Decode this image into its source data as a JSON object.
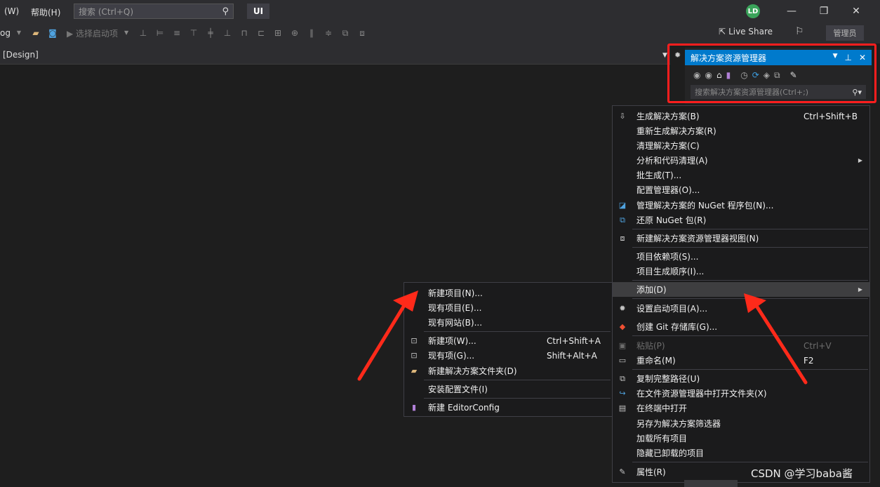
{
  "titlebar": {
    "menu_window": "(W)",
    "menu_help": "帮助(H)",
    "search_placeholder": "搜索 (Ctrl+Q)",
    "project_badge": "UI",
    "avatar_initials": "LD"
  },
  "toolbar": {
    "config_fragment": "og",
    "start_label": "▶ 选择启动项",
    "live_share": "Live Share",
    "admin_label": "管理员"
  },
  "document": {
    "tab_label": "[Design]"
  },
  "solution_explorer": {
    "title": "解决方案资源管理器",
    "search_placeholder": "搜索解决方案资源管理器(Ctrl+;)"
  },
  "context_menu": {
    "items": [
      {
        "label": "生成解决方案(B)",
        "shortcut": "Ctrl+Shift+B",
        "icon": "build-icon"
      },
      {
        "label": "重新生成解决方案(R)",
        "shortcut": "",
        "icon": ""
      },
      {
        "label": "清理解决方案(C)",
        "shortcut": "",
        "icon": ""
      },
      {
        "label": "分析和代码清理(A)",
        "shortcut": "",
        "icon": ""
      },
      {
        "label": "批生成(T)...",
        "shortcut": "",
        "icon": ""
      },
      {
        "label": "配置管理器(O)...",
        "shortcut": "",
        "icon": ""
      },
      {
        "label": "管理解决方案的 NuGet 程序包(N)...",
        "shortcut": "",
        "icon": "nuget-icon"
      },
      {
        "label": "还原 NuGet 包(R)",
        "shortcut": "",
        "icon": "restore-icon"
      },
      {
        "label": "新建解决方案资源管理器视图(N)",
        "shortcut": "",
        "icon": "new-view-icon"
      },
      {
        "label": "项目依赖项(S)...",
        "shortcut": "",
        "icon": ""
      },
      {
        "label": "项目生成顺序(I)...",
        "shortcut": "",
        "icon": ""
      },
      {
        "label": "添加(D)",
        "shortcut": "",
        "icon": ""
      },
      {
        "label": "设置启动项目(A)...",
        "shortcut": "",
        "icon": "gear-icon"
      },
      {
        "label": "创建 Git 存储库(G)...",
        "shortcut": "",
        "icon": "git-icon"
      },
      {
        "label": "粘贴(P)",
        "shortcut": "Ctrl+V",
        "icon": "paste-icon"
      },
      {
        "label": "重命名(M)",
        "shortcut": "F2",
        "icon": "rename-icon"
      },
      {
        "label": "复制完整路径(U)",
        "shortcut": "",
        "icon": "copy-path-icon"
      },
      {
        "label": "在文件资源管理器中打开文件夹(X)",
        "shortcut": "",
        "icon": "open-folder-icon"
      },
      {
        "label": "在终端中打开",
        "shortcut": "",
        "icon": "terminal-icon"
      },
      {
        "label": "另存为解决方案筛选器",
        "shortcut": "",
        "icon": ""
      },
      {
        "label": "加载所有项目",
        "shortcut": "",
        "icon": ""
      },
      {
        "label": "隐藏已卸载的项目",
        "shortcut": "",
        "icon": ""
      },
      {
        "label": "属性(R)",
        "shortcut": "",
        "icon": "wrench-icon"
      }
    ]
  },
  "add_submenu": {
    "items": [
      {
        "label": "新建项目(N)...",
        "shortcut": ""
      },
      {
        "label": "现有项目(E)...",
        "shortcut": ""
      },
      {
        "label": "现有网站(B)...",
        "shortcut": ""
      },
      {
        "label": "新建项(W)...",
        "shortcut": "Ctrl+Shift+A"
      },
      {
        "label": "现有项(G)...",
        "shortcut": "Shift+Alt+A"
      },
      {
        "label": "新建解决方案文件夹(D)",
        "shortcut": ""
      },
      {
        "label": "安装配置文件(I)",
        "shortcut": ""
      },
      {
        "label": "新建 EditorConfig",
        "shortcut": ""
      }
    ]
  },
  "watermark": "CSDN @学习baba酱",
  "colors": {
    "accent": "#007acc",
    "highlight_frame": "#ff1e1e",
    "arrow": "#ff2a1a"
  }
}
